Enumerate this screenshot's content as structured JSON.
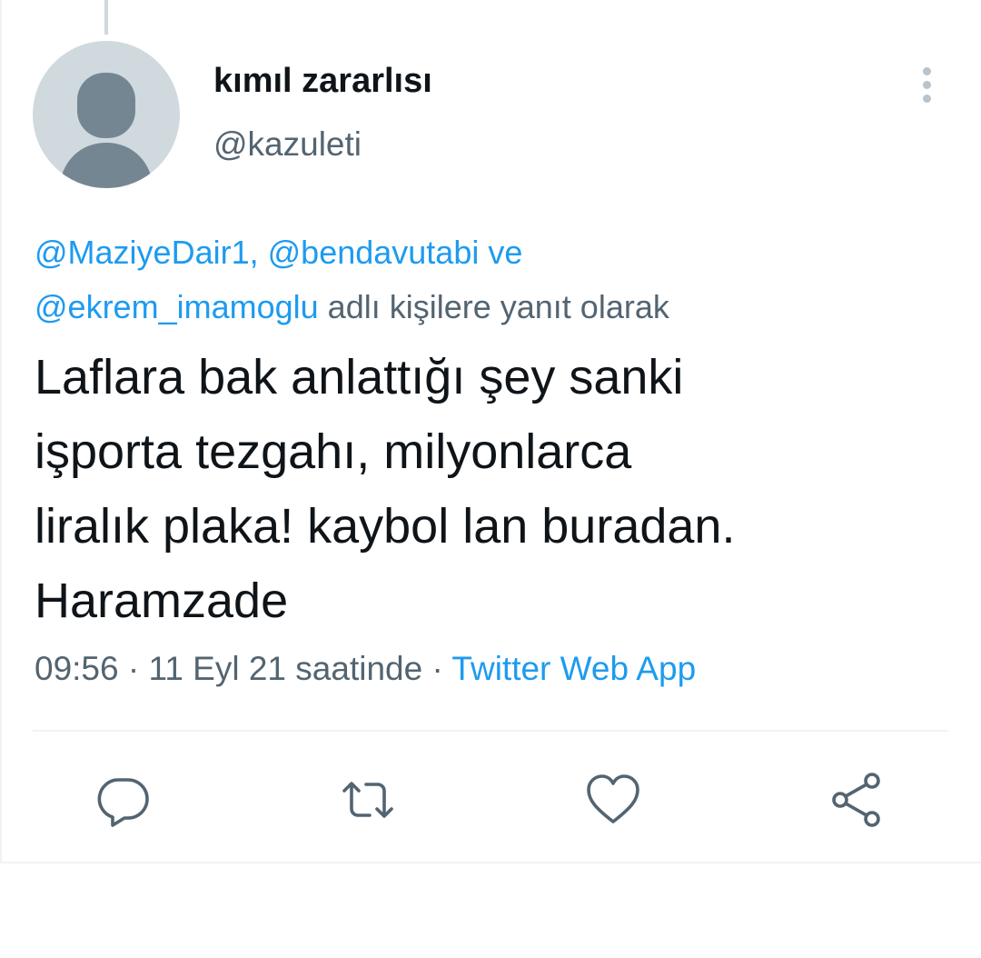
{
  "user": {
    "display_name": "kımıl zararlısı",
    "handle": "@kazuleti"
  },
  "reply_context": {
    "mention_1": "@MaziyeDair1,",
    "mention_2": "@bendavutabi",
    "joiner": "ve",
    "mention_3": "@ekrem_imamoglu",
    "suffix": "adlı kişilere yanıt olarak"
  },
  "tweet": {
    "text": "Laflara bak anlattığı şey sanki\nişporta tezgahı, milyonlarca\nliralık plaka! kaybol lan buradan.\nHaramzade"
  },
  "meta": {
    "time": "09:56",
    "separator": "·",
    "date": "11 Eyl 21 saatinde",
    "source": "Twitter Web App"
  },
  "icons": {
    "more": "more-vertical-icon",
    "reply": "reply-icon",
    "retweet": "retweet-icon",
    "like": "like-heart-icon",
    "share": "share-icon"
  },
  "colors": {
    "accent": "#1d9bf0",
    "text": "#0f1419",
    "secondary": "#536471",
    "avatar_bg": "#cfd9de"
  }
}
